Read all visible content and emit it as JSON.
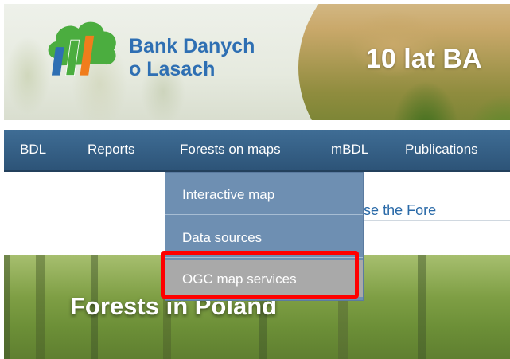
{
  "header": {
    "logo_text_line1": "Bank Danych",
    "logo_text_line2": "o Lasach",
    "slogan": "10 lat BA",
    "logo_colors": [
      "#4bad3f",
      "#2e6fb3",
      "#f07d1c"
    ]
  },
  "nav": {
    "items": [
      {
        "label": "BDL"
      },
      {
        "label": "Reports"
      },
      {
        "label": "Forests on maps"
      },
      {
        "label": "mBDL"
      },
      {
        "label": "Publications"
      }
    ]
  },
  "dropdown": {
    "items": [
      {
        "label": "Interactive map"
      },
      {
        "label": "Data sources"
      },
      {
        "label": "OGC map services",
        "state": "hover"
      }
    ]
  },
  "content": {
    "welcome_text": "e you to use the Fore",
    "hero_title": "Forests in Poland"
  },
  "colors": {
    "navbar": "#2d5478",
    "dropdown": "#6e8fb2",
    "highlight": "#ff0000",
    "link": "#2a6aa8"
  }
}
